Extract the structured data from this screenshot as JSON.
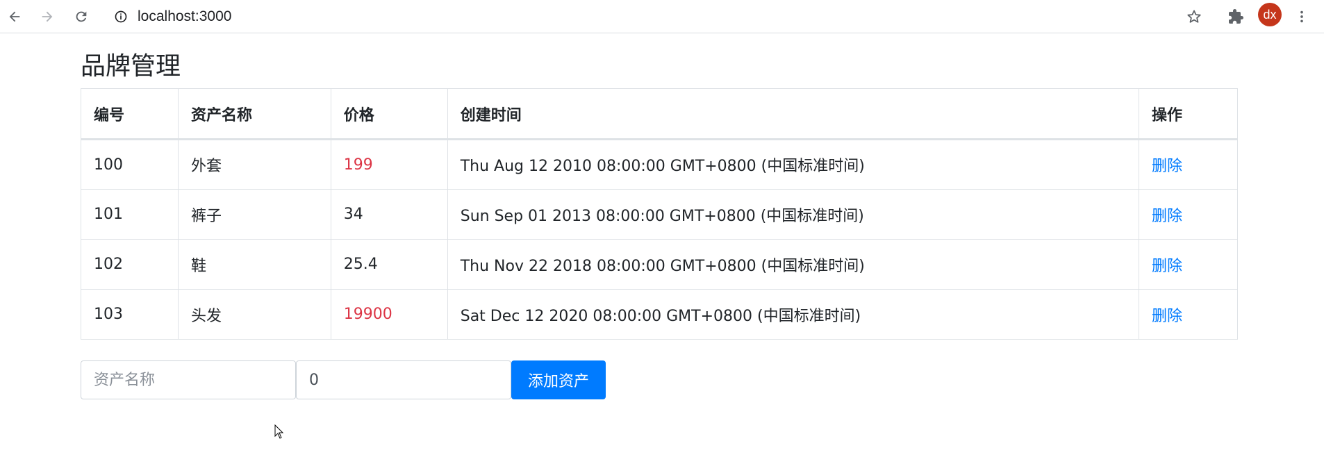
{
  "browser": {
    "url": "localhost:3000",
    "profile_initials": "dx",
    "profile_color": "#c5361b",
    "icons": [
      "back-arrow-icon",
      "forward-arrow-icon",
      "reload-icon",
      "info-icon",
      "star-icon",
      "puzzle-icon",
      "kebab-menu-icon"
    ]
  },
  "page": {
    "title": "品牌管理"
  },
  "table": {
    "headers": [
      "编号",
      "资产名称",
      "价格",
      "创建时间",
      "操作"
    ],
    "rows": [
      {
        "id": "100",
        "name": "外套",
        "price": "199",
        "created": "Thu Aug 12 2010 08:00:00 GMT+0800 (中国标准时间)",
        "action": "删除",
        "price_highlight": true
      },
      {
        "id": "101",
        "name": "裤子",
        "price": "34",
        "created": "Sun Sep 01 2013 08:00:00 GMT+0800 (中国标准时间)",
        "action": "删除",
        "price_highlight": false
      },
      {
        "id": "102",
        "name": "鞋",
        "price": "25.4",
        "created": "Thu Nov 22 2018 08:00:00 GMT+0800 (中国标准时间)",
        "action": "删除",
        "price_highlight": false
      },
      {
        "id": "103",
        "name": "头发",
        "price": "19900",
        "created": "Sat Dec 12 2020 08:00:00 GMT+0800 (中国标准时间)",
        "action": "删除",
        "price_highlight": true
      }
    ]
  },
  "form": {
    "name_placeholder": "资产名称",
    "name_value": "",
    "price_value": "0",
    "add_label": "添加资产"
  },
  "colors": {
    "accent": "#007bff",
    "price_highlight": "#dc3545"
  }
}
